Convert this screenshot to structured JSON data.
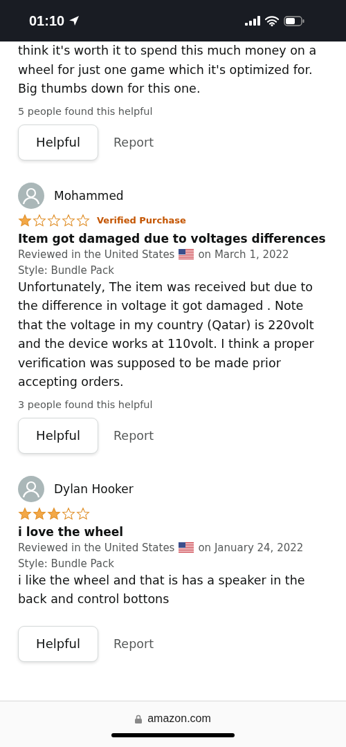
{
  "status_bar": {
    "time": "01:10"
  },
  "reviews": [
    {
      "body": "think it's worth it to spend this much money on a wheel for just one game which it's optimized for. Big thumbs down for this one.",
      "helpful_count": "5 people found this helpful",
      "helpful_label": "Helpful",
      "report_label": "Report"
    },
    {
      "name": "Mohammed",
      "stars": 1,
      "verified": "Verified Purchase",
      "title": "Item got damaged due to voltages differences",
      "location": "Reviewed in the United States",
      "date": "on March 1, 2022",
      "style": "Style: Bundle Pack",
      "body": "Unfortunately, The item was received but due to the difference in voltage it got damaged . Note that the voltage in my country (Qatar) is 220volt and the device works at 110volt. I think a proper verification was supposed to be made prior accepting orders.",
      "helpful_count": "3 people found this helpful",
      "helpful_label": "Helpful",
      "report_label": "Report"
    },
    {
      "name": "Dylan Hooker",
      "stars": 3,
      "title": "i love the wheel",
      "location": "Reviewed in the United States",
      "date": "on January 24, 2022",
      "style": "Style: Bundle Pack",
      "body": "i like the wheel and that is has a speaker in the back and control bottons",
      "helpful_label": "Helpful",
      "report_label": "Report"
    }
  ],
  "browser_bar": {
    "url": "amazon.com"
  }
}
